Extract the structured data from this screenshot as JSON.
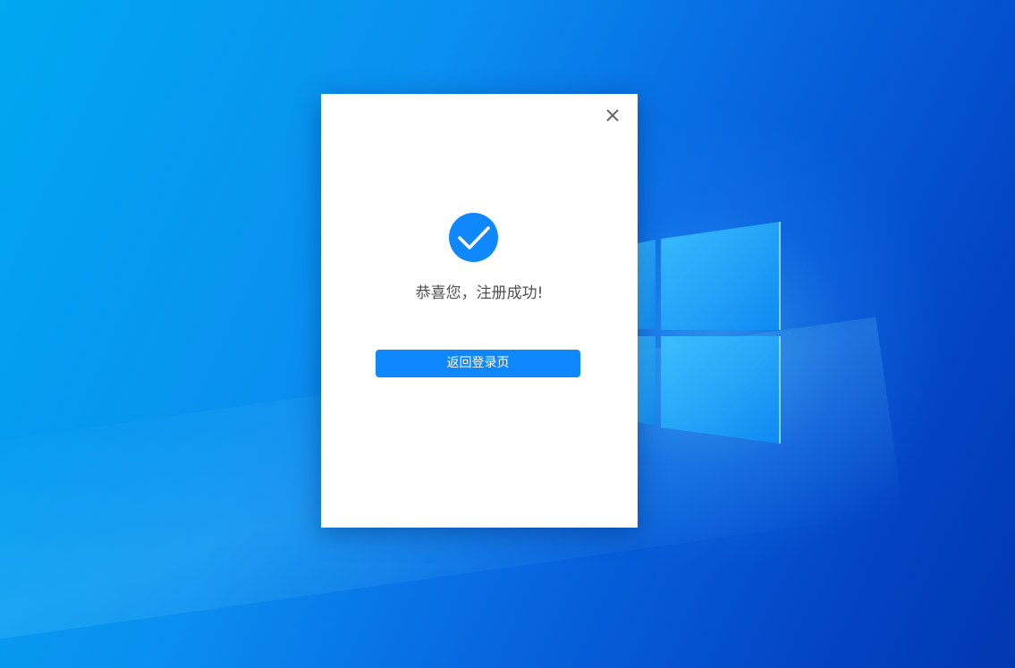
{
  "dialog": {
    "message": "恭喜您，注册成功!",
    "return_button_label": "返回登录页"
  },
  "icons": {
    "close": "close-icon",
    "success": "check-circle-icon",
    "desktop_logo": "windows-logo-icon"
  },
  "colors": {
    "accent": "#1088FD",
    "dialog_background": "#FFFFFF",
    "message_text": "#505050",
    "close_icon": "#666666"
  }
}
